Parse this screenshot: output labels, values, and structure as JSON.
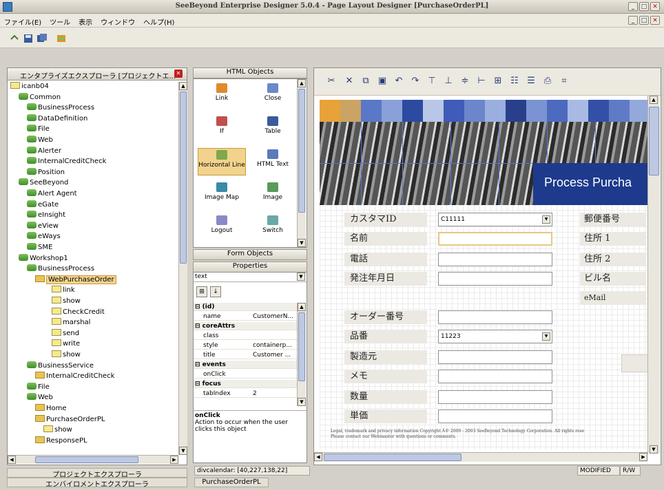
{
  "window": {
    "title": "SeeBeyond Enterprise Designer 5.0.4 - Page Layout Designer [PurchaseOrderPL]"
  },
  "menubar": {
    "items": [
      "ファイル(E)",
      "ツール",
      "表示",
      "ウィンドウ",
      "ヘルプ(H)"
    ]
  },
  "explorer": {
    "title": "エンタプライズエクスプローラ [プロジェクトエ...",
    "root": "icanb04",
    "items": [
      {
        "label": "Common",
        "indent": 1
      },
      {
        "label": "BusinessProcess",
        "indent": 2
      },
      {
        "label": "DataDefinition",
        "indent": 2
      },
      {
        "label": "File",
        "indent": 2
      },
      {
        "label": "Web",
        "indent": 2
      },
      {
        "label": "Alerter",
        "indent": 2
      },
      {
        "label": "InternalCreditCheck",
        "indent": 2
      },
      {
        "label": "Position",
        "indent": 2
      },
      {
        "label": "SeeBeyond",
        "indent": 1
      },
      {
        "label": "Alert Agent",
        "indent": 2
      },
      {
        "label": "eGate",
        "indent": 2
      },
      {
        "label": "eInsight",
        "indent": 2
      },
      {
        "label": "eView",
        "indent": 2
      },
      {
        "label": "eWays",
        "indent": 2
      },
      {
        "label": "SME",
        "indent": 2
      },
      {
        "label": "Workshop1",
        "indent": 1
      },
      {
        "label": "BusinessProcess",
        "indent": 2
      },
      {
        "label": "WebPurchaseOrder",
        "indent": 3
      },
      {
        "label": "link",
        "indent": 5
      },
      {
        "label": "show",
        "indent": 5
      },
      {
        "label": "CheckCredit",
        "indent": 5
      },
      {
        "label": "marshal",
        "indent": 5
      },
      {
        "label": "send",
        "indent": 5
      },
      {
        "label": "write",
        "indent": 5
      },
      {
        "label": "show",
        "indent": 5
      },
      {
        "label": "BusinessService",
        "indent": 2
      },
      {
        "label": "InternalCreditCheck",
        "indent": 3
      },
      {
        "label": "File",
        "indent": 2
      },
      {
        "label": "Web",
        "indent": 2
      },
      {
        "label": "Home",
        "indent": 3
      },
      {
        "label": "PurchaseOrderPL",
        "indent": 3
      },
      {
        "label": "show",
        "indent": 4
      },
      {
        "label": "ResponsePL",
        "indent": 3
      }
    ],
    "selected": "WebPurchaseOrder",
    "bottom_tabs": [
      "プロジェクトエクスプローラ",
      "エンバイロメントエクスプローラ"
    ]
  },
  "palette": {
    "title": "HTML Objects",
    "objects": [
      {
        "label": "Link",
        "icon": "link-icon"
      },
      {
        "label": "Close",
        "icon": "close-obj-icon"
      },
      {
        "label": "If",
        "icon": "if-icon"
      },
      {
        "label": "Table",
        "icon": "table-icon"
      },
      {
        "label": "Horizontal Line",
        "icon": "horizontal-line-icon"
      },
      {
        "label": "HTML Text",
        "icon": "html-text-icon"
      },
      {
        "label": "Image Map",
        "icon": "image-map-icon"
      },
      {
        "label": "Image",
        "icon": "image-icon"
      },
      {
        "label": "Logout",
        "icon": "logout-icon"
      },
      {
        "label": "Switch",
        "icon": "switch-icon"
      }
    ],
    "selected": "Horizontal Line",
    "form_objects_title": "Form Objects"
  },
  "properties": {
    "title": "Properties",
    "selector_value": "text",
    "rows": [
      {
        "cat": true,
        "key": "⊟ (id)"
      },
      {
        "key": "name",
        "value": "CustomerN..."
      },
      {
        "cat": true,
        "key": "⊟ coreAttrs"
      },
      {
        "key": "class",
        "value": ""
      },
      {
        "key": "style",
        "value": "containerp..."
      },
      {
        "key": "title",
        "value": "Customer ..."
      },
      {
        "cat": true,
        "key": "⊟ events"
      },
      {
        "key": "onClick",
        "value": ""
      },
      {
        "cat": true,
        "key": "⊟ focus"
      },
      {
        "key": "tabIndex",
        "value": "2"
      }
    ],
    "desc_title": "onClick",
    "desc_text": "Action to occur when the user clicks this object"
  },
  "editor": {
    "banner_title": "Process Purcha",
    "left_fields": [
      {
        "label": "カスタマID",
        "value": "C11111",
        "dropdown": true
      },
      {
        "label": "名前",
        "value": "",
        "focus": true
      },
      {
        "label": "電話",
        "value": ""
      },
      {
        "label": "発注年月日",
        "value": ""
      },
      {
        "label": "オーダー番号",
        "value": ""
      },
      {
        "label": "品番",
        "value": "11223",
        "dropdown": true
      },
      {
        "label": "製造元",
        "value": ""
      },
      {
        "label": "メモ",
        "value": ""
      },
      {
        "label": "数量",
        "value": ""
      },
      {
        "label": "単価",
        "value": ""
      }
    ],
    "right_labels": [
      "郵便番号",
      "住所 1",
      "住所 2",
      "ビル名",
      "eMail"
    ],
    "footer_line1": "Legal, trademark and privacy information Copyright Â© 2000 - 2003 SeeBeyond Technology Corporation. All rights rese",
    "footer_line2": "Please contact our Webmaster with questions or comments."
  },
  "status": {
    "position": "divcalendar: [40,227,138,22]",
    "state": "MODIFIED",
    "mode": "R/W",
    "tab": "PurchaseOrderPL"
  },
  "colors": {
    "banner_navy": "#1d3a8c",
    "selection": "#f2d38e",
    "panel_border": "#8d8d8d"
  }
}
